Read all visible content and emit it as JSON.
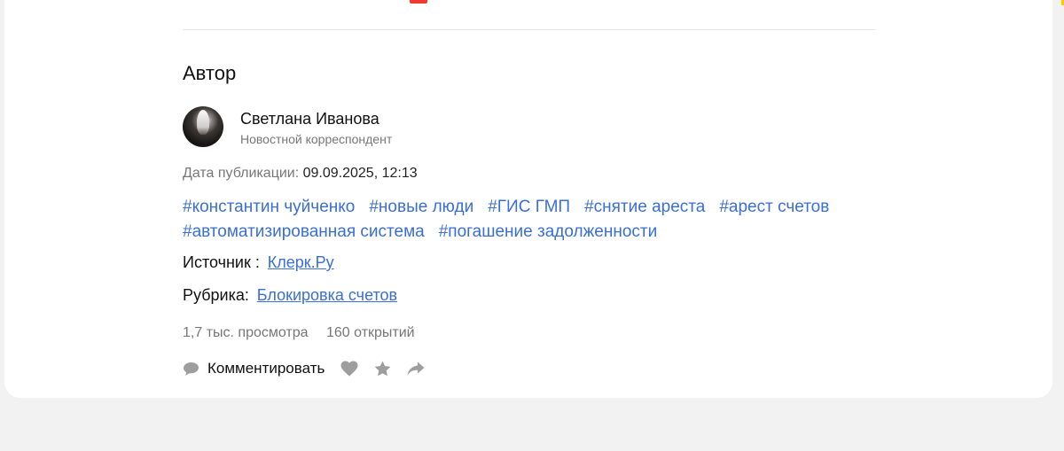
{
  "author_section": {
    "title": "Автор",
    "name": "Светлана Иванова",
    "role": "Новостной корреспондент"
  },
  "publication": {
    "label": "Дата публикации:",
    "value": "09.09.2025, 12:13"
  },
  "tags": [
    "#константин чуйченко",
    "#новые люди",
    "#ГИС ГМП",
    "#снятие ареста",
    "#арест счетов",
    "#автоматизированная система",
    "#погашение задолженности"
  ],
  "source": {
    "label": "Источник :",
    "link": "Клерк.Ру"
  },
  "rubric": {
    "label": "Рубрика:",
    "link": "Блокировка счетов"
  },
  "stats": {
    "views": "1,7 тыс. просмотра",
    "opens": "160 открытий"
  },
  "actions": {
    "comment_label": "Комментировать",
    "icons": [
      "comment-icon",
      "heart-icon",
      "star-icon",
      "share-icon"
    ]
  },
  "colors": {
    "link": "#3a6fd8",
    "muted": "#777777",
    "icon": "#9e9e9e",
    "background": "#f2f2f2"
  }
}
